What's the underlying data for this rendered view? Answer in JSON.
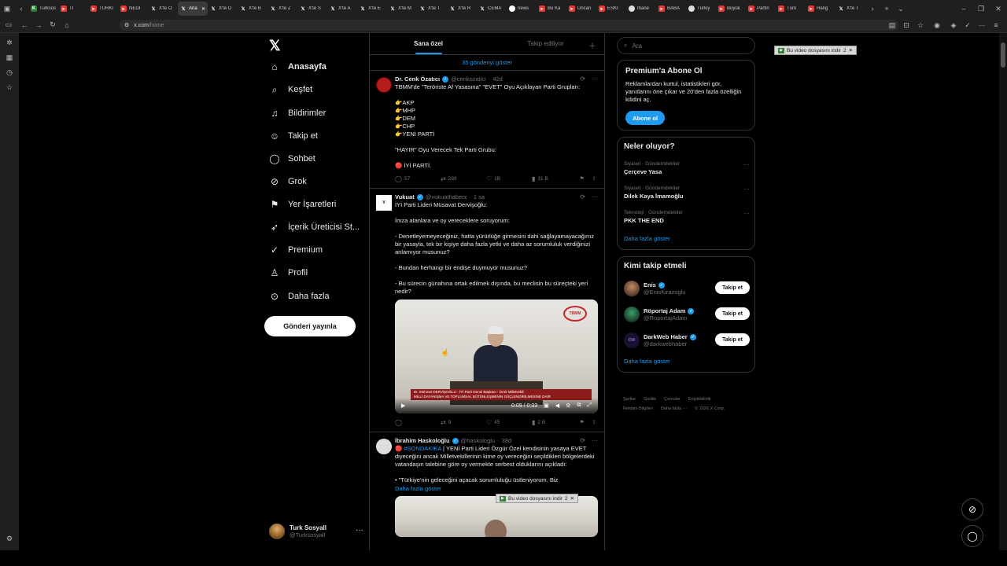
{
  "browser": {
    "tabs": [
      {
        "icon": "k",
        "label": "Turksos"
      },
      {
        "icon": "yt",
        "label": "Tİ"
      },
      {
        "icon": "yt",
        "label": "TÜRKİ"
      },
      {
        "icon": "yt",
        "label": "NEDİ"
      },
      {
        "icon": "x",
        "label": "X'te Ö"
      },
      {
        "icon": "x",
        "label": "Ana",
        "active": true
      },
      {
        "icon": "x",
        "label": "X'te D"
      },
      {
        "icon": "x",
        "label": "X'te B"
      },
      {
        "icon": "x",
        "label": "X'te Z"
      },
      {
        "icon": "x",
        "label": "X'te S"
      },
      {
        "icon": "x",
        "label": "X'te A"
      },
      {
        "icon": "x",
        "label": "X'te E"
      },
      {
        "icon": "x",
        "label": "X'te M"
      },
      {
        "icon": "x",
        "label": "X'te T"
      },
      {
        "icon": "x",
        "label": "X'te R"
      },
      {
        "icon": "x",
        "label": "CEMA"
      },
      {
        "icon": "g",
        "label": "news"
      },
      {
        "icon": "yt",
        "label": "Bu Ka"
      },
      {
        "icon": "yt",
        "label": "Uncan"
      },
      {
        "icon": "yt",
        "label": "ESKİ"
      },
      {
        "icon": "dot",
        "label": "İhane"
      },
      {
        "icon": "yt",
        "label": "BABA"
      },
      {
        "icon": "dot",
        "label": "Türkiy"
      },
      {
        "icon": "yt",
        "label": "Büyük"
      },
      {
        "icon": "yt",
        "label": "Partin"
      },
      {
        "icon": "yt",
        "label": "Tüm"
      },
      {
        "icon": "yt",
        "label": "Hang"
      },
      {
        "icon": "x",
        "label": "X'te T"
      }
    ],
    "url_host": "x.com",
    "url_path": "/home",
    "download_badge": "Bu video dosyasını indir",
    "download_badge_num": "2"
  },
  "nav": {
    "items": [
      {
        "label": "Anasayfa",
        "icon": "home-icon"
      },
      {
        "label": "Keşfet",
        "icon": "search-icon"
      },
      {
        "label": "Bildirimler",
        "icon": "bell-icon"
      },
      {
        "label": "Takip et",
        "icon": "follow-icon"
      },
      {
        "label": "Sohbet",
        "icon": "chat-icon"
      },
      {
        "label": "Grok",
        "icon": "grok-icon"
      },
      {
        "label": "Yer İşaretleri",
        "icon": "bookmark-icon"
      },
      {
        "label": "İçerik Üreticisi St...",
        "icon": "rocket-icon"
      },
      {
        "label": "Premium",
        "icon": "premium-icon"
      },
      {
        "label": "Profil",
        "icon": "profile-icon"
      },
      {
        "label": "Daha fazla",
        "icon": "more-icon"
      }
    ],
    "post_button": "Gönderi yayınla",
    "me": {
      "name": "Turk Sosyall",
      "handle": "@Turksosyall"
    }
  },
  "feed": {
    "tabs": [
      "Sana özel",
      "Takip ediliyor"
    ],
    "show_more": "35 gönderiyi göster",
    "tweets": [
      {
        "name": "Dr. Cenk Özatıcı",
        "handle": "@cenkozatici",
        "time": "42d",
        "text": "TBMM'de \"Teröriste Af Yasasına\" \"EVET\" Oyu Açıklayan Parti Grupları:\n\n👉AKP\n👉MHP\n👉DEM\n👉CHP\n👉YENİ PARTİ\n\n\"HAYIR\" Oyu Verecek Tek Parti Grubu:\n\n🔴 İYİ PARTİ.",
        "replies": "57",
        "reposts": "289",
        "likes": "1B",
        "views": "31 B"
      },
      {
        "name": "Vukuat",
        "handle": "@vukuathaberx",
        "time": "1 sa",
        "text": "İYİ Parti Lideri Müsavat Dervişoğlu:\n\nİmza atanlara ve oy vereceklere soruyorum:\n\n- Denetleyemeyeceğiniz, hatta yürürlüğe girmesini dahi sağlayamayacağınız bir yasayla, tek bir kişiye daha fazla yetki ve daha az sorumluluk verdiğinizi anlamıyor musunuz?\n\n- Bundan herhangi bir endişe duymuyor musunuz?\n\n- Bu sürecin günahına ortak edilmek dışında, bu meclisin bu süreçteki yeri nedir?",
        "video": {
          "time": "0:09 / 0:33",
          "lower_third_1": "Dr. Mehmet DERVİŞOĞLU - İYİ Parti Genel Başkanı - İzmir Milletvekili",
          "lower_third_2": "MİLLİ DAYANIŞMA VE TOPLUMSAL BÜTÜNLEŞMENİN GÜÇLENDİRİLMESİNE DAİR",
          "channel_logo": "TBMM"
        },
        "replies": "",
        "reposts": "9",
        "likes": "45",
        "views": "2 B"
      },
      {
        "name": "İbrahim Haskoloğlu",
        "handle": "@haskologlu",
        "time": "38d",
        "hashtag": "#SONDAKİKA",
        "text": " | YENİ Parti Lideri Özgür Özel kendisinin yasaya EVET diyeceğini ancak Milletvekillerinin kime oy vereceğini seçildikleri bölgelerdeki vatandaşın talebine göre oy vermekte serbest olduklarını açıkladı:\n\n• \"Türkiye'nin geleceğini açacak sorumluluğu üstleniyorum. Biz",
        "show_more": "Daha fazla göster"
      }
    ]
  },
  "sidebar": {
    "search_placeholder": "Ara",
    "premium": {
      "title": "Premium'a Abone Ol",
      "text": "Reklamlardan kurtul, istatistikleri gör, yanıtlarını öne çıkar ve 20'den fazla özelliğin kilidini aç.",
      "button": "Abone ol"
    },
    "trends": {
      "title": "Neler oluyor?",
      "items": [
        {
          "category": "Siyaset · Gündemdekiler",
          "name": "Çerçeve Yasa"
        },
        {
          "category": "Siyaset · Gündemdekiler",
          "name": "Dilek Kaya İmamoğlu"
        },
        {
          "category": "Teknoloji · Gündemdekiler",
          "name": "PKK THE END"
        }
      ],
      "show_more": "Daha fazla göster"
    },
    "who_to_follow": {
      "title": "Kimi takip etmeli",
      "items": [
        {
          "name": "Enis",
          "handle": "@EnisKirazoglu"
        },
        {
          "name": "Röportaj Adam",
          "handle": "@RoportajAdam"
        },
        {
          "name": "DarkWeb Haber",
          "handle": "@darkwebhaber"
        }
      ],
      "follow_label": "Takip et",
      "show_more": "Daha fazla göster"
    },
    "footer": [
      "Şartlar",
      "Gizlilik",
      "Çerezler",
      "Erişilebilirlik",
      "Reklam Bilgileri",
      "Daha fazla ···",
      "© 2026 X Corp."
    ]
  }
}
